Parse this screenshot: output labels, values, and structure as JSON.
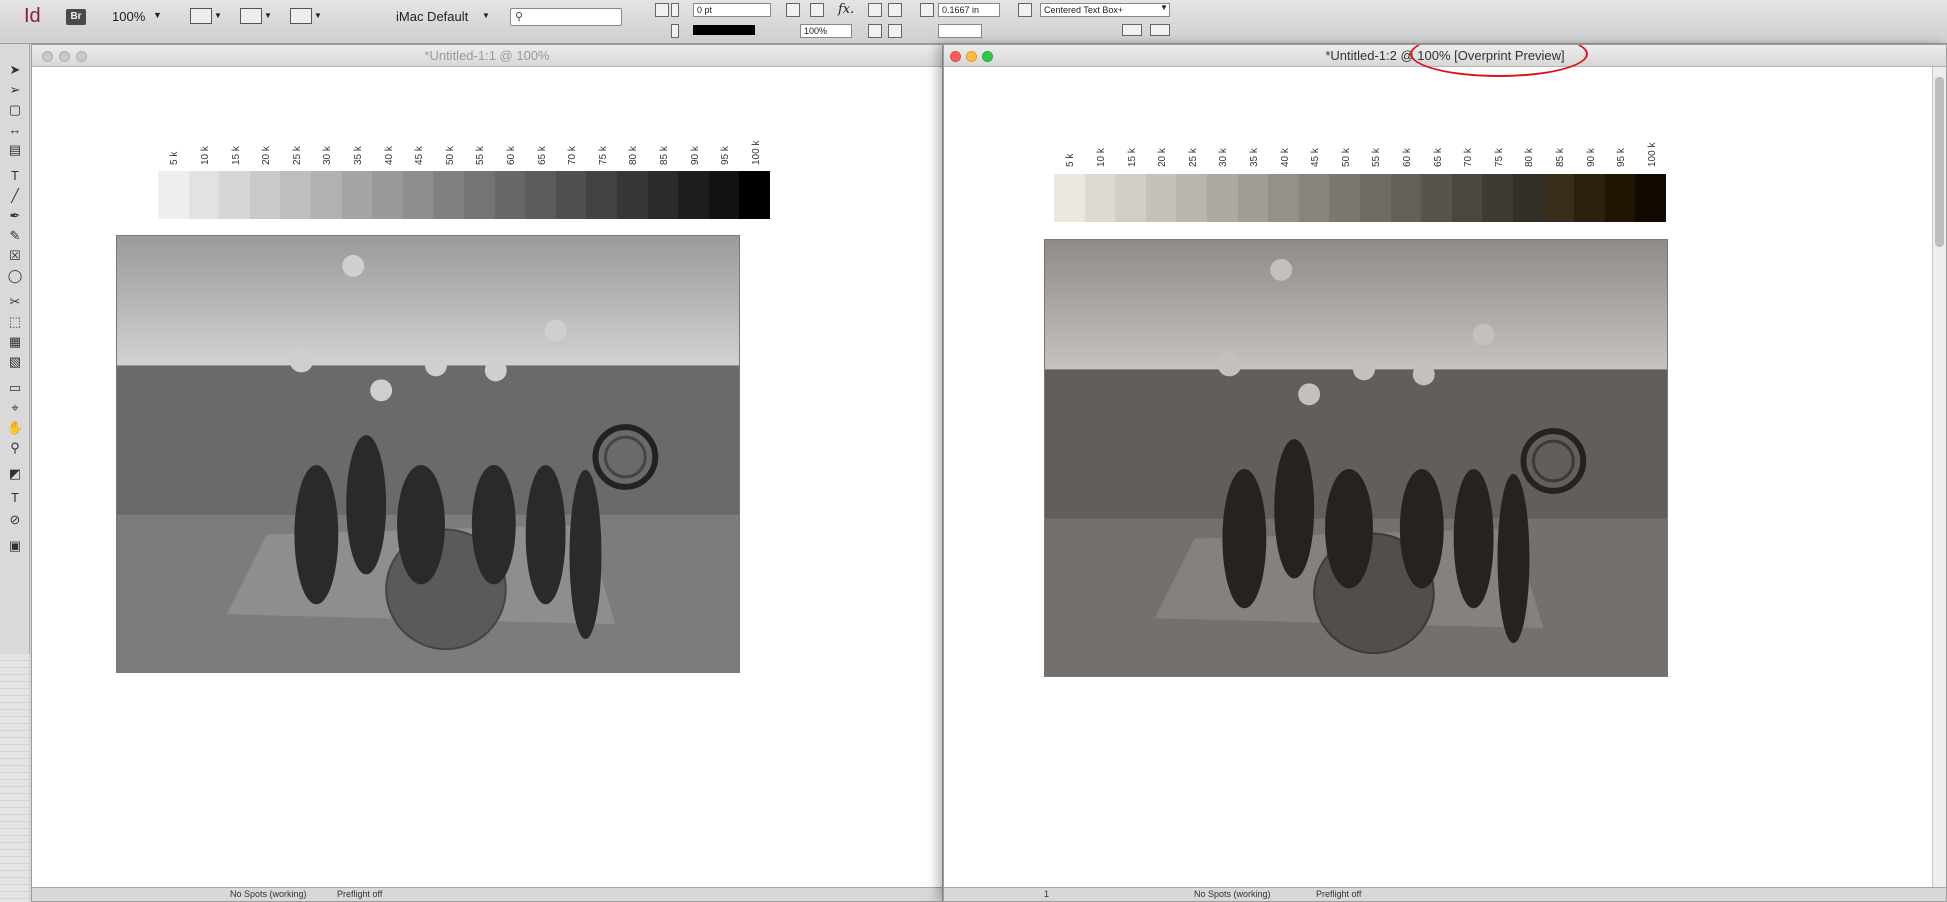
{
  "app": {
    "logo": "Id",
    "bridge": "Br",
    "zoom": "100%",
    "workspace": "iMac Default",
    "stroke_weight": "0 pt",
    "opacity": "100%",
    "ref_value": "0.1667 in",
    "text_frame_style": "Centered Text Box+"
  },
  "windows": [
    {
      "title": "*Untitled-1:1 @ 100%",
      "status": {
        "page": "",
        "spots": "No Spots (working)",
        "preflight": "Preflight off"
      }
    },
    {
      "title": "*Untitled-1:2 @ 100% [Overprint Preview]",
      "status": {
        "page": "1",
        "spots": "No Spots (working)",
        "preflight": "Preflight off"
      }
    }
  ],
  "ramp": {
    "labels": [
      "5 k",
      "10 k",
      "15 k",
      "20 k",
      "25 k",
      "30 k",
      "35 k",
      "40 k",
      "45 k",
      "50 k",
      "55 k",
      "60 k",
      "65 k",
      "70 k",
      "75 k",
      "80 k",
      "85 k",
      "90 k",
      "95 k",
      "100 k"
    ],
    "values": [
      5,
      10,
      15,
      20,
      25,
      30,
      35,
      40,
      45,
      50,
      55,
      60,
      65,
      70,
      75,
      80,
      85,
      90,
      95,
      100
    ]
  },
  "tools": [
    "selection",
    "direct-selection",
    "page",
    "gap",
    "content-collector",
    "type",
    "line",
    "pen",
    "pencil",
    "rectangle-frame",
    "ellipse",
    "scissors",
    "free-transform",
    "gradient",
    "gradient-feather",
    "note",
    "eyedropper",
    "hand",
    "zoom",
    "fill-stroke",
    "formatting",
    "preview-mode"
  ],
  "colors": {
    "annotation": "#d9141a",
    "brand": "#8b1f35"
  }
}
